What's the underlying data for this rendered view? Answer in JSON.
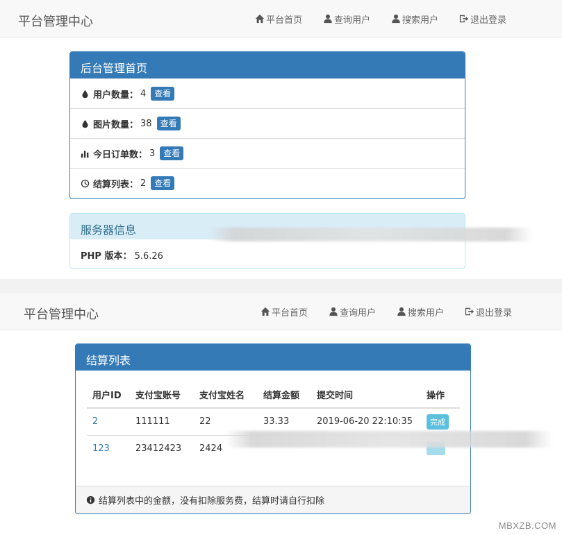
{
  "screen1": {
    "brand": "平台管理中心",
    "nav": [
      {
        "label": "平台首页",
        "icon": "home-icon"
      },
      {
        "label": "查询用户",
        "icon": "user-icon"
      },
      {
        "label": "搜索用户",
        "icon": "user-icon"
      },
      {
        "label": "退出登录",
        "icon": "logout-icon"
      }
    ],
    "dashboard": {
      "title": "后台管理首页",
      "rows": [
        {
          "icon": "drop-icon",
          "label": "用户数量：",
          "value": "4",
          "button": "查看"
        },
        {
          "icon": "drop-icon",
          "label": "图片数量：",
          "value": "38",
          "button": "查看"
        },
        {
          "icon": "bar-chart-icon",
          "label": "今日订单数：",
          "value": "3",
          "button": "查看"
        },
        {
          "icon": "clock-icon",
          "label": "结算列表：",
          "value": "2",
          "button": "查看"
        }
      ]
    },
    "server": {
      "title": "服务器信息",
      "php_label": "PHP 版本：",
      "php_value": "5.6.26"
    }
  },
  "screen2": {
    "brand": "平台管理中心",
    "nav": [
      {
        "label": "平台首页",
        "icon": "home-icon"
      },
      {
        "label": "查询用户",
        "icon": "user-icon"
      },
      {
        "label": "搜索用户",
        "icon": "user-icon"
      },
      {
        "label": "退出登录",
        "icon": "logout-icon"
      }
    ],
    "settlement": {
      "title": "结算列表",
      "columns": [
        "用户ID",
        "支付宝账号",
        "支付宝姓名",
        "结算金额",
        "提交时间",
        "操作"
      ],
      "rows": [
        {
          "user_id": "2",
          "account": "111111",
          "name": "22",
          "amount": "33.33",
          "time": "2019-06-20 22:10:35",
          "action": "完成"
        },
        {
          "user_id": "123",
          "account": "23412423",
          "name": "2424",
          "amount": "",
          "time": "",
          "action": ""
        }
      ],
      "footer_note": "结算列表中的金额，没有扣除服务费，结算时请自行扣除"
    }
  },
  "watermark": "MBXZB.COM",
  "colors": {
    "primary": "#337ab7",
    "info_bg": "#d9edf7",
    "info_text": "#31708f",
    "success_badge": "#5bc0de"
  }
}
